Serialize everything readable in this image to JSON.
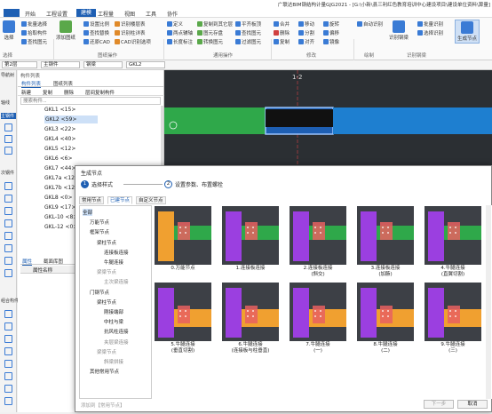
{
  "title": "广联达BIM钢结构计量GJG2021 - [G:\\小新\\县三利红色教育培训中心建设项目\\建设单位资料\\算量]",
  "menu": [
    "开始",
    "工程设置",
    "建模",
    "工程量",
    "视图",
    "工具",
    "协作"
  ],
  "menu_active": 2,
  "ribbon": {
    "select": "选择",
    "g1": [
      "批量选择",
      "拾取构件",
      "查找图元"
    ],
    "g2": [
      "添加图纸"
    ],
    "g3": [
      "设置比例",
      "查找替换",
      "还原CAD"
    ],
    "g4": [
      "识别楼层表",
      "识别柱详表",
      "CAD识别选项"
    ],
    "g5": [
      "定义",
      "两点辅轴",
      "长度标注"
    ],
    "g6": [
      "复制到其它层",
      "图元存盘",
      "转换图元"
    ],
    "g7": [
      "平齐板顶",
      "查找图元",
      "过滤图元"
    ],
    "g8": [
      "合并",
      "删除",
      "复制",
      "移动",
      "分割",
      "对齐",
      "旋转",
      "偏移",
      "镜像",
      "阵列"
    ],
    "g9": [
      "自动识别",
      "识别",
      "校核"
    ],
    "g10": [
      "识别钢梁",
      "批量识别",
      "选择识别"
    ],
    "gen_node": "生成节点",
    "groups": [
      "选择",
      "图纸操作",
      "通用操作",
      "修改",
      "绘制",
      "识别钢梁"
    ]
  },
  "toolbar2": {
    "floor": "第2层",
    "type": "主钢件",
    "sub": "钢梁",
    "name": "GKL2"
  },
  "leftstrip": {
    "nav": "导航树",
    "items": [
      "轴线",
      "主钢件",
      "次钢件",
      "组合构件"
    ]
  },
  "panel": {
    "title": "构件列表",
    "tabs": [
      "构件列表",
      "图纸列表"
    ],
    "tools": [
      "新建",
      "复制",
      "删除",
      "层间复制构件"
    ],
    "search_placeholder": "搜索构件...",
    "items": [
      "GKL1 <15>",
      "GKL2 <59>",
      "GKL3 <22>",
      "GKL4 <40>",
      "GKL5 <12>",
      "GKL6 <6>",
      "GKL7 <44>",
      "GKL7a <12>",
      "GKL7b <12>",
      "GKL8 <0>",
      "GKL9 <17>",
      "GKL-10 <8>",
      "GKL-12 <0>"
    ],
    "selected": 1,
    "prop_tabs": [
      "属性",
      "截面库图"
    ],
    "prop_header": "属性名称"
  },
  "canvas": {
    "axis_label": "1-2"
  },
  "dialog": {
    "title": "生成节点",
    "steps": [
      {
        "num": "1",
        "label": "选择样式"
      },
      {
        "num": "2",
        "label": "设置参数、布置螺栓"
      }
    ],
    "tabs": [
      "常用节点",
      "已建节点",
      "自定义节点"
    ],
    "tree": [
      {
        "t": "全部",
        "lvl": 0,
        "sel": true
      },
      {
        "t": "万能节点",
        "lvl": 1
      },
      {
        "t": "框架节点",
        "lvl": 1
      },
      {
        "t": "梁柱节点",
        "lvl": 2
      },
      {
        "t": "连接板连接",
        "lvl": 3
      },
      {
        "t": "牛腿连接",
        "lvl": 3
      },
      {
        "t": "梁梁节点",
        "lvl": 2,
        "g": true
      },
      {
        "t": "主次梁连接",
        "lvl": 3,
        "g": true
      },
      {
        "t": "门钢节点",
        "lvl": 1
      },
      {
        "t": "梁柱节点",
        "lvl": 2
      },
      {
        "t": "刚接端部",
        "lvl": 3
      },
      {
        "t": "中柱与梁",
        "lvl": 3
      },
      {
        "t": "抗风柱连接",
        "lvl": 3
      },
      {
        "t": "夹层梁连接",
        "lvl": 3,
        "g": true
      },
      {
        "t": "梁梁节点",
        "lvl": 2,
        "g": true
      },
      {
        "t": "斜梁拼接",
        "lvl": 3,
        "g": true
      },
      {
        "t": "其他常用节点",
        "lvl": 1
      }
    ],
    "nodes": [
      "0.万能节点",
      "1.连接板连接",
      "2.连接板连接\n(斜交)",
      "3.连接板连接\n(加腋)",
      "4.牛腿连接\n(直翼切割)",
      "5.牛腿连接\n(垂直切割)",
      "6.牛腿连接\n(连接板与柱垂直)",
      "7.牛腿连接\n(一)",
      "8.牛腿连接\n(二)",
      "9.牛腿连接\n(三)"
    ],
    "add_link": "添加到【常用节点】",
    "next": "下一步",
    "cancel": "取消"
  },
  "colors": {
    "accent": "#1e5fb3",
    "purple": "#9b3fe0",
    "orange": "#f0a030",
    "green": "#2fa84a",
    "steel": "#3b6fa0"
  }
}
